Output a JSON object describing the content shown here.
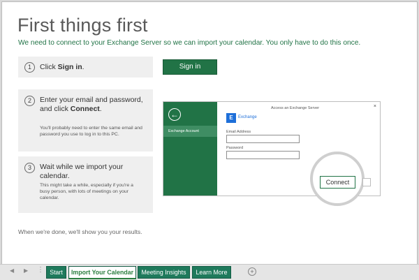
{
  "page": {
    "title": "First things first",
    "subtitle": "We need to connect to your Exchange Server so we can import your calendar. You only have to do this once.",
    "footer_note": "When we're done, we'll show you your results."
  },
  "steps": [
    {
      "number": "1",
      "main_prefix": "Click ",
      "main_bold": "Sign in",
      "main_suffix": "."
    },
    {
      "number": "2",
      "main_prefix": "Enter your email and password, and click ",
      "main_bold": "Connect",
      "main_suffix": ".",
      "note": "You'll probably need to enter the same email and password you use to log in to this PC."
    },
    {
      "number": "3",
      "main_prefix": "Wait while we import your calendar.",
      "note": "This might take a while, especially if you're a busy person, with lots of meetings on your calendar."
    }
  ],
  "buttons": {
    "sign_in": "Sign in",
    "connect": "Connect"
  },
  "mock_dialog": {
    "title": "Access an Exchange Server",
    "app_name": "Exchange",
    "account_label": "Exchange Account",
    "email_label": "Email Address",
    "password_label": "Password",
    "close_symbol": "×"
  },
  "tabs": [
    {
      "label": "Start"
    },
    {
      "label": "Import Your Calendar"
    },
    {
      "label": "Meeting Insights"
    },
    {
      "label": "Learn More"
    }
  ],
  "tabbar": {
    "add_symbol": "+",
    "nav_left": "◀",
    "nav_right": "▶",
    "dots": "⋮"
  },
  "colors": {
    "accent": "#217346",
    "light_panel": "#efefef",
    "active_tab_text": "#2a7d3e"
  }
}
